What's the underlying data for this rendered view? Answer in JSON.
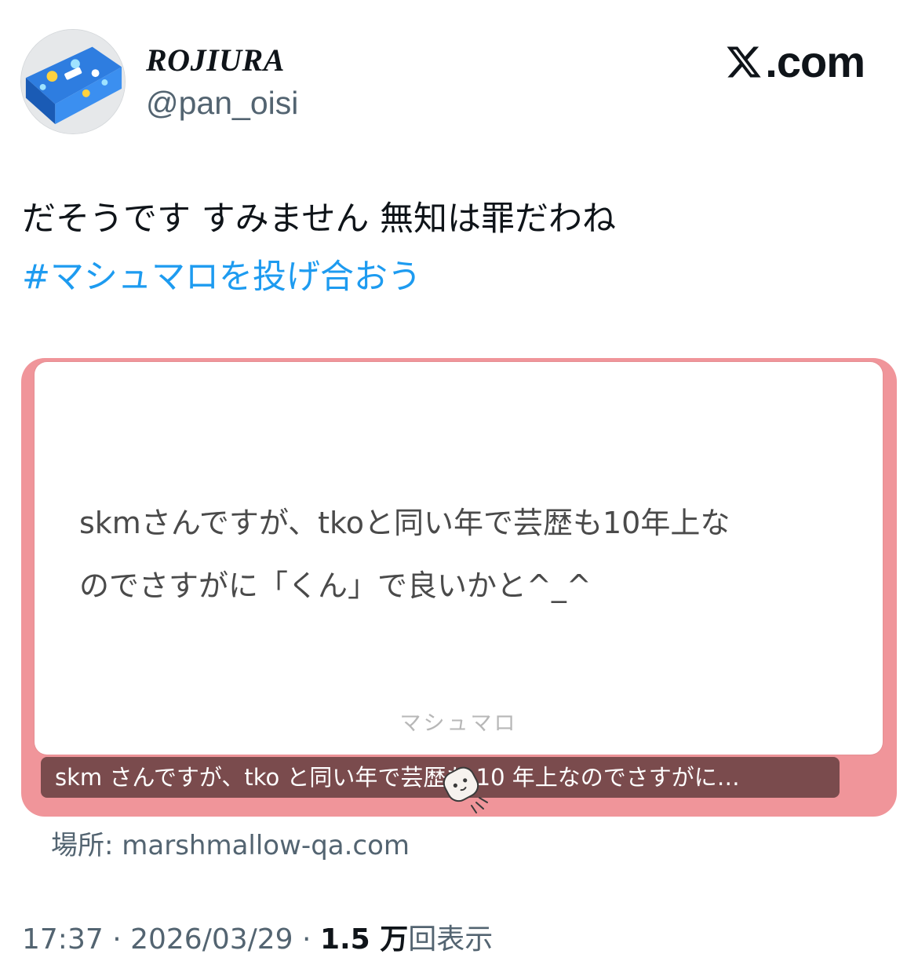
{
  "author": {
    "display_name": "ROJIURA",
    "handle": "@pan_oisi",
    "avatar_icon": "candy-box-avatar"
  },
  "brand": {
    "icon": "x-logo-icon",
    "text": ".com"
  },
  "tweet": {
    "text": "だそうです すみません 無知は罪だわね",
    "hashtag": "#マシュマロを投げ合おう"
  },
  "card": {
    "question_lines": [
      "skmさんですが、tkoと同い年で芸歴も10年上な",
      "のでさすがに「くん」で良いかと^_^"
    ],
    "footer_brand": "マシュマロ",
    "caption": "skm さんですが、tko と同い年で芸歴も 10 年上なのでさすがに…",
    "colors": {
      "frame": "#f0959a",
      "caption_bg": "#7a4b4d"
    }
  },
  "source": {
    "label": "場所: ",
    "domain": "marshmallow-qa.com"
  },
  "meta": {
    "time": "17:37",
    "date": "2026/03/29",
    "separator": " · ",
    "views_count": "1.5 万",
    "views_label": "回表示"
  }
}
